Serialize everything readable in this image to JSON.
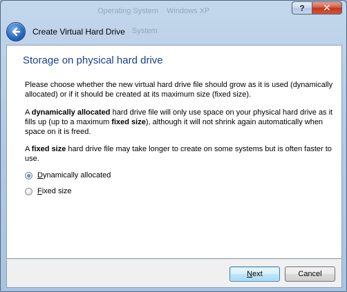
{
  "window": {
    "title": "Create Virtual Hard Drive",
    "ghost_text_1": "Operating System",
    "ghost_text_2": "Windows XP",
    "ghost_text_3": "System",
    "help_label": "?",
    "close_label": "✕"
  },
  "page": {
    "heading": "Storage on physical hard drive",
    "p1": "Please choose whether the new virtual hard drive file should grow as it is used (dynamically allocated) or if it should be created at its maximum size (fixed size).",
    "p2_prefix": "A ",
    "p2_bold1": "dynamically allocated",
    "p2_mid": " hard drive file will only use space on your physical hard drive as it fills up (up to a maximum ",
    "p2_bold2": "fixed size",
    "p2_suffix": "), although it will not shrink again automatically when space on it is freed.",
    "p3_prefix": "A ",
    "p3_bold": "fixed size",
    "p3_suffix": " hard drive file may take longer to create on some systems but is often faster to use."
  },
  "options": {
    "dynamic_first": "D",
    "dynamic_rest": "ynamically allocated",
    "dynamic_selected": true,
    "fixed_first": "F",
    "fixed_rest": "ixed size",
    "fixed_selected": false
  },
  "buttons": {
    "next_first": "N",
    "next_rest": "ext",
    "cancel": "Cancel"
  },
  "colors": {
    "heading": "#1a3e8a",
    "frame": "#b3cbe4",
    "default_button": "#bee6fd"
  }
}
